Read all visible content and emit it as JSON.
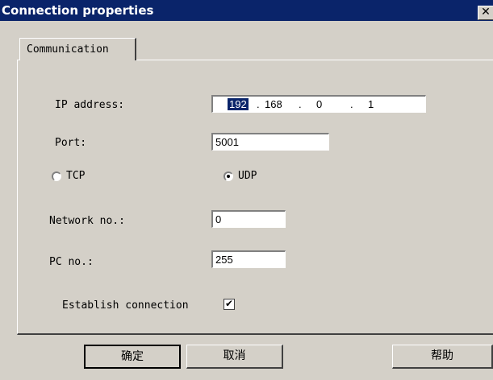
{
  "window": {
    "title": "Connection properties",
    "close_glyph": "✕"
  },
  "tabs": [
    {
      "label": "Communication"
    }
  ],
  "form": {
    "ip_label": "IP address:",
    "ip_octets": [
      "192",
      "168",
      "0",
      "1"
    ],
    "ip_separator": ".",
    "port_label": "Port:",
    "port_value": "5001",
    "tcp_label": "TCP",
    "udp_label": "UDP",
    "protocol_selected": "UDP",
    "network_label": "Network no.:",
    "network_value": "0",
    "pc_label": "PC no.:",
    "pc_value": "255",
    "establish_label": "Establish connection",
    "establish_checked": true,
    "check_glyph": "✔"
  },
  "buttons": {
    "ok": "确定",
    "cancel": "取消",
    "help": "帮助"
  }
}
